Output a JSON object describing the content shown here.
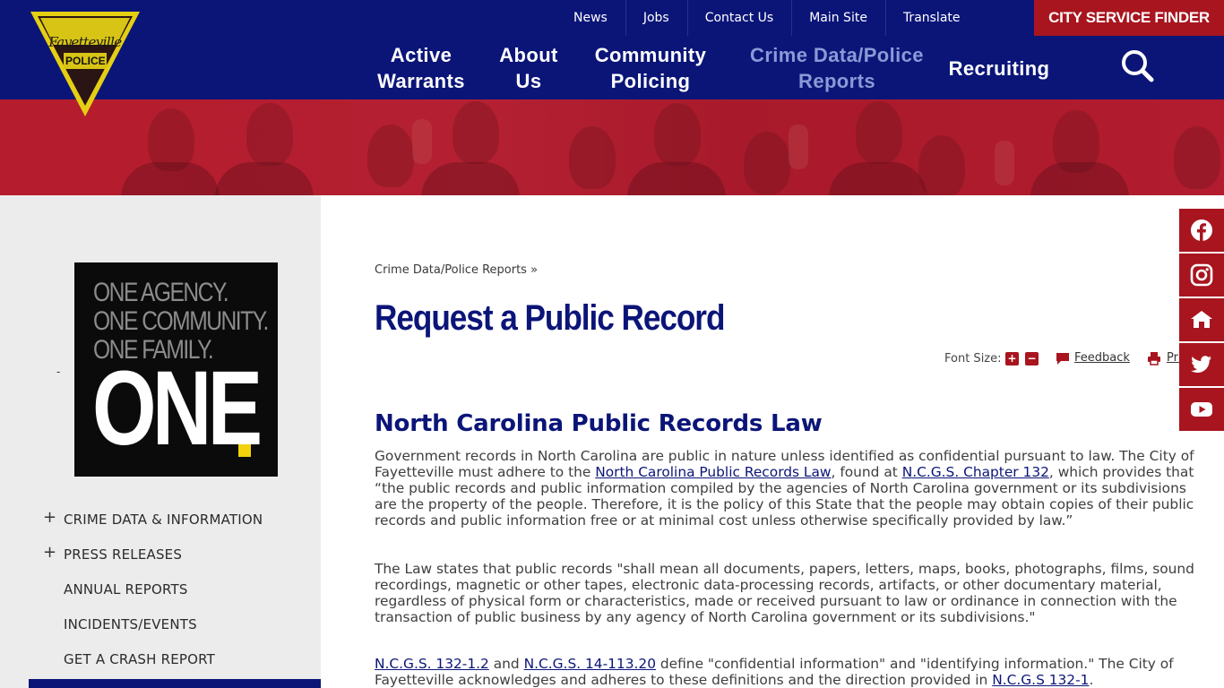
{
  "header": {
    "utility_links": [
      "News",
      "Jobs",
      "Contact Us",
      "Main Site",
      "Translate"
    ],
    "service_finder": "CITY SERVICE FINDER",
    "nav": [
      {
        "label": "Active Warrants"
      },
      {
        "label": "About Us"
      },
      {
        "label": "Community Policing"
      },
      {
        "label": "Crime Data/Police Reports",
        "active": true
      },
      {
        "label": "Recruiting"
      }
    ],
    "search_icon": "search-icon",
    "logo": {
      "wordmark": "Fayetteville",
      "badge": "POLICE"
    }
  },
  "sidebar": {
    "promo": {
      "lines": [
        "ONE AGENCY.",
        "ONE COMMUNITY.",
        "ONE FAMILY."
      ],
      "big": "ONE"
    },
    "dash": "-",
    "items": [
      {
        "label": "CRIME DATA & INFORMATION",
        "expandable": true
      },
      {
        "label": "PRESS RELEASES",
        "expandable": true
      },
      {
        "label": "ANNUAL REPORTS",
        "expandable": false
      },
      {
        "label": "INCIDENTS/EVENTS",
        "expandable": false
      },
      {
        "label": "GET A CRASH REPORT",
        "expandable": false
      }
    ]
  },
  "main": {
    "breadcrumb": "Crime Data/Police Reports »",
    "title": "Request a Public Record",
    "tools": {
      "font_size_label": "Font Size:",
      "increase": "+",
      "decrease": "−",
      "feedback": "Feedback",
      "print": "Print"
    },
    "section_heading": "North Carolina Public Records Law",
    "p1": {
      "t1": "Government records in North Carolina are public in nature unless identified as confidential pursuant to law. The City of Fayetteville must adhere to the ",
      "link1": "North Carolina Public Records Law",
      "t2": ", found at ",
      "link2": "N.C.G.S. Chapter 132",
      "t3": ", which provides that “the public records and public information compiled by the agencies of North Carolina government or its subdivisions are the property of the people.  Therefore, it is the policy of this State that the people may obtain copies of their public records and public information free or at minimal cost unless otherwise specifically provided by law.”"
    },
    "p2": "The Law states that public records \"shall mean all documents, papers, letters, maps, books, photographs, films, sound recordings, magnetic or other tapes, electronic data-processing records, artifacts, or other documentary material, regardless of physical form or characteristics, made or received pursuant to law or ordinance in connection with the transaction of public business by any agency of North Carolina government or its subdivisions.\"",
    "p3": {
      "link1": "N.C.G.S. 132-1.2",
      "t1": " and ",
      "link2": "N.C.G.S. 14-113.20",
      "t2": " define \"confidential information\" and \"identifying information.\"  The City of Fayetteville acknowledges and adheres to these definitions and the direction provided in ",
      "link3": "N.C.G.S 132-1",
      "t3": "."
    }
  },
  "social": [
    "facebook-icon",
    "instagram-icon",
    "nextdoor-icon",
    "twitter-icon",
    "youtube-icon"
  ],
  "colors": {
    "navy": "#0b1578",
    "red": "#a8151f",
    "sidebar_bg": "#ececec",
    "nav_active": "#8a9ad6"
  }
}
